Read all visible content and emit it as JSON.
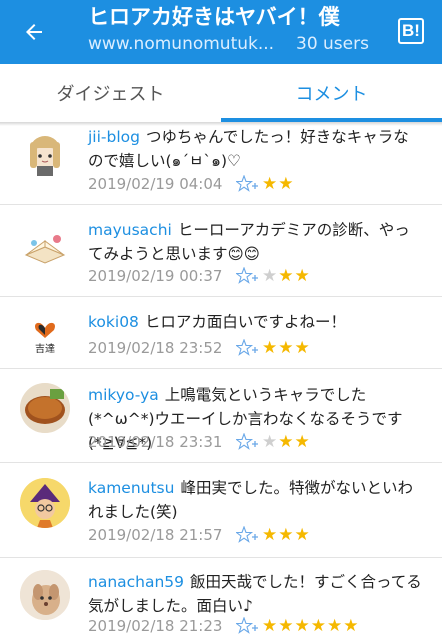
{
  "header": {
    "title": "ヒロアカ好きはヤバイ！僕",
    "url": "www.nomunomutuk...",
    "users": "30 users",
    "b_button": "B!"
  },
  "tabs": [
    {
      "label": "ダイジェスト",
      "active": false
    },
    {
      "label": "コメント",
      "active": true
    }
  ],
  "colors": {
    "accent": "#1d8fe1",
    "star_yellow": "#f5b800",
    "star_grey": "#cfcfcf"
  },
  "comments": [
    {
      "user": "jii-blog",
      "text": "つゆちゃんでしたっ！好きなキャラなので嬉しい(๑´ㅂ`๑)♡",
      "date": "2019/02/19 04:04",
      "stars": 2,
      "grey_stars": 0
    },
    {
      "user": "mayusachi",
      "text": "ヒーローアカデミアの診断、やってみようと思います😊😊",
      "date": "2019/02/19 00:37",
      "stars": 2,
      "grey_stars": 1
    },
    {
      "user": "koki08",
      "text": "ヒロアカ面白いですよねー！",
      "date": "2019/02/18 23:52",
      "stars": 3,
      "grey_stars": 0
    },
    {
      "user": "mikyo-ya",
      "text": "上鳴電気というキャラでした(*^ω^*)ウエーイしか言わなくなるそうです(*≧∀≦*)",
      "date": "2019/02/18 23:31",
      "stars": 2,
      "grey_stars": 1
    },
    {
      "user": "kamenutsu",
      "text": "峰田実でした。特徴がないといわれました(笑)",
      "date": "2019/02/18 21:57",
      "stars": 3,
      "grey_stars": 0
    },
    {
      "user": "nanachan59",
      "text": "飯田天哉でした！すごく合ってる気がしました。面白い♪",
      "date": "2019/02/18 21:23",
      "stars": 6,
      "grey_stars": 0
    }
  ]
}
